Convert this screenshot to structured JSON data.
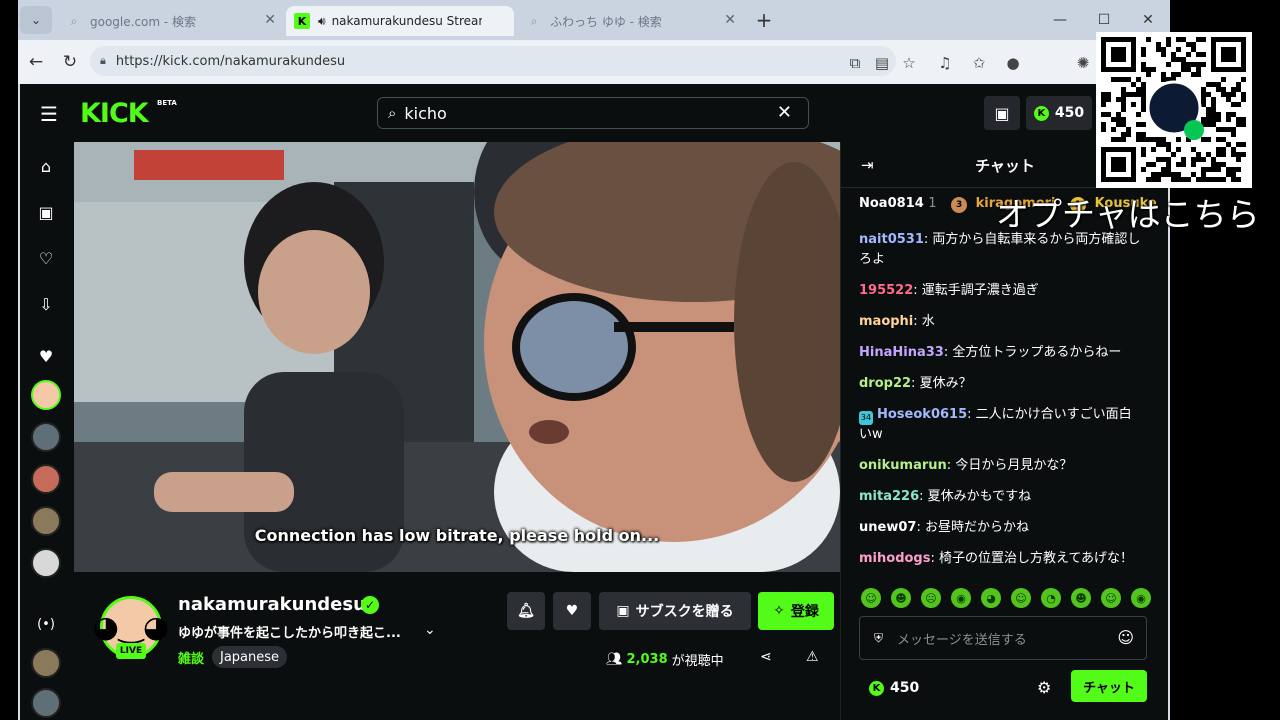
{
  "browser": {
    "tabs": [
      {
        "title": "google.com - 検索",
        "icon": "search-icon"
      },
      {
        "title": "nakamurakundesu Stream - W",
        "icon": "kick-favicon",
        "audio_icon": "speaker-icon"
      },
      {
        "title": "ふわっち ゆゆ - 検索",
        "icon": "search-icon"
      }
    ],
    "new_tab": "+",
    "window_controls": {
      "minimize": "—",
      "maximize": "☐",
      "close": "✕"
    },
    "url": "https://kick.com/nakamurakundesu"
  },
  "kick": {
    "logo": "KICK",
    "beta": "BETA",
    "search_value": "kicho",
    "points": "450",
    "video": {
      "subtitle": "Connection has low bitrate, please hold on..."
    },
    "channel": {
      "name": "nakamurakundesu",
      "live_badge": "LIVE",
      "stream_title": "ゆゆが事件を起こしたから叩き起こ...",
      "category": "雑談",
      "language": "Japanese",
      "gift_sub_label": "サブスクを贈る",
      "subscribe_label": "登録",
      "viewer_count": "2,038",
      "viewers_suffix": "が視聴中"
    },
    "chat": {
      "title": "チャット",
      "gifters": [
        {
          "name": "Noa0814",
          "count": "1"
        },
        {
          "rank": "3",
          "name": "kiragomori"
        },
        {
          "rank": "1",
          "name": "Kousuke"
        }
      ],
      "messages": [
        {
          "user": "nait0531",
          "color": "#a3b8ff",
          "text": "両方から自転車来るから両方確認しろよ"
        },
        {
          "user": "195522",
          "color": "#ff6b8a",
          "text": "運転手調子濃き過ぎ"
        },
        {
          "user": "maophi",
          "color": "#ffd39b",
          "text": "水"
        },
        {
          "user": "HinaHina33",
          "color": "#c3a6ff",
          "text": "全方位トラップあるからねー"
        },
        {
          "user": "drop22",
          "color": "#b4f08a",
          "text": "夏休み？"
        },
        {
          "user": "Hoseok0615",
          "color": "#a3b8ff",
          "badge": "34",
          "text": "二人にかけ合いすごい面白いw"
        },
        {
          "user": "onikumarun",
          "color": "#b4f08a",
          "text": "今日から月見かな？"
        },
        {
          "user": "mita226",
          "color": "#8ae6c8",
          "text": "夏休みかもですね"
        },
        {
          "user": "unew07",
          "color": "#ffffff",
          "text": "お昼時だからかね"
        },
        {
          "user": "mihodogs",
          "color": "#ff9ecb",
          "text": "椅子の位置治し方教えてあげな！"
        }
      ],
      "input_placeholder": "メッセージを送信する",
      "points": "450",
      "send_label": "チャット"
    }
  },
  "overlay": {
    "text": "オプチャはこちら"
  }
}
